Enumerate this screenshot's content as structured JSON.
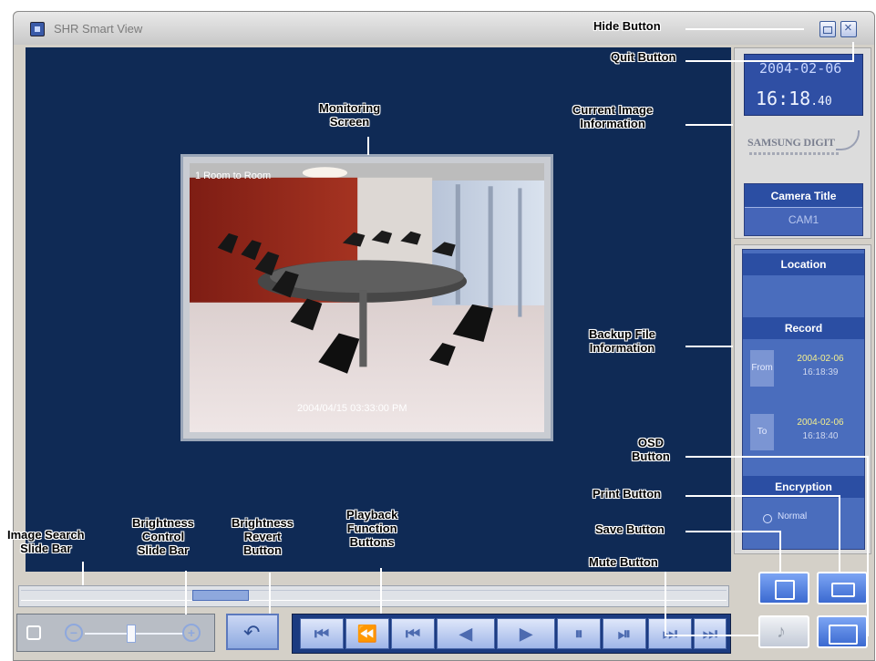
{
  "window": {
    "title": "SHR Smart View"
  },
  "monitor": {
    "osd_top": "1 Room to Room",
    "osd_bottom": "2004/04/15 03:33:00 PM"
  },
  "info": {
    "date": "2004-02-06",
    "time": "16:18",
    "time_fraction": ".40",
    "brand": "SAMSUNG DIGIT",
    "camera_title_label": "Camera Title",
    "camera_title_value": "CAM1"
  },
  "backup": {
    "location_label": "Location",
    "record_label": "Record",
    "from_label": "From",
    "from_date": "2004-02-06",
    "from_time": "16:18:39",
    "to_label": "To",
    "to_date": "2004-02-06",
    "to_time": "16:18:40",
    "encryption_label": "Encryption",
    "encryption_option": "Normal"
  },
  "callouts": {
    "hide": "Hide Button",
    "quit": "Quit Button",
    "monitoring": "Monitoring\nScreen",
    "current": "Current Image\nInformation",
    "backup": "Backup File\nInformation",
    "osd": "OSD\nButton",
    "print": "Print Button",
    "save": "Save Button",
    "mute": "Mute Button",
    "image_search": "Image Search\nSlide Bar",
    "brightness_control": "Brightness\nControl\nSlide Bar",
    "brightness_revert": "Brightness\nRevert\nButton",
    "playback": "Playback\nFunction\nButtons"
  },
  "playback_buttons": [
    "⏮",
    "⏪",
    "⏮",
    "◀",
    "▶",
    "⏸",
    "⏯",
    "⏭",
    "⏭"
  ],
  "icons": {
    "hide": "minimize-icon",
    "quit": "close-icon",
    "save": "floppy-icon",
    "print": "printer-icon",
    "mute": "speaker-mute-icon",
    "osd": "osd-icon",
    "revert": "undo-icon"
  },
  "colors": {
    "monitor_bg": "#0f2a55",
    "panel_blue": "#2b4ea3",
    "accent": "#4a6dbd",
    "date_highlight": "#f4ef8e"
  }
}
